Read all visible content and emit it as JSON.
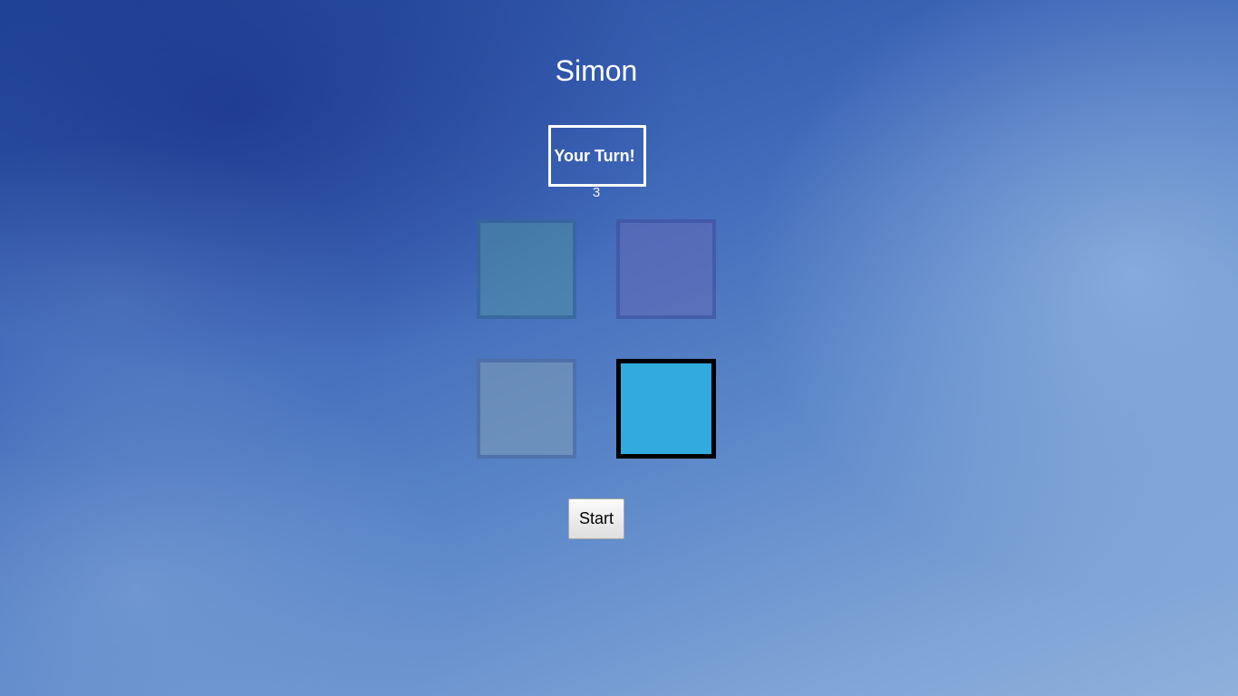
{
  "game": {
    "title": "Simon",
    "status_text": "Your Turn!",
    "count": "3",
    "start_label": "Start"
  },
  "pads": [
    {
      "name": "green-pad",
      "color": "#4f8fa0",
      "lit": false
    },
    {
      "name": "purple-pad",
      "color": "#6a66b4",
      "lit": false
    },
    {
      "name": "yellow-pad",
      "color": "#7f9db4",
      "lit": false
    },
    {
      "name": "blue-pad",
      "color": "#33aadf",
      "lit": true
    }
  ]
}
